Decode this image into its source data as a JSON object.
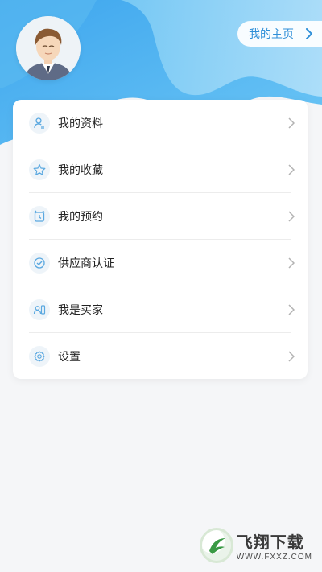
{
  "header": {
    "home_label": "我的主页",
    "accent": "#4fb0ec"
  },
  "menu": {
    "items": [
      {
        "label": "我的资料",
        "icon": "user-profile-icon"
      },
      {
        "label": "我的收藏",
        "icon": "star-icon"
      },
      {
        "label": "我的预约",
        "icon": "alarm-clock-icon"
      },
      {
        "label": "供应商认证",
        "icon": "verified-badge-icon"
      },
      {
        "label": "我是买家",
        "icon": "buyer-card-icon"
      },
      {
        "label": "设置",
        "icon": "gear-icon"
      }
    ]
  },
  "watermark": {
    "cn": "飞翔下载",
    "en": "WWW.FXXZ.COM"
  }
}
